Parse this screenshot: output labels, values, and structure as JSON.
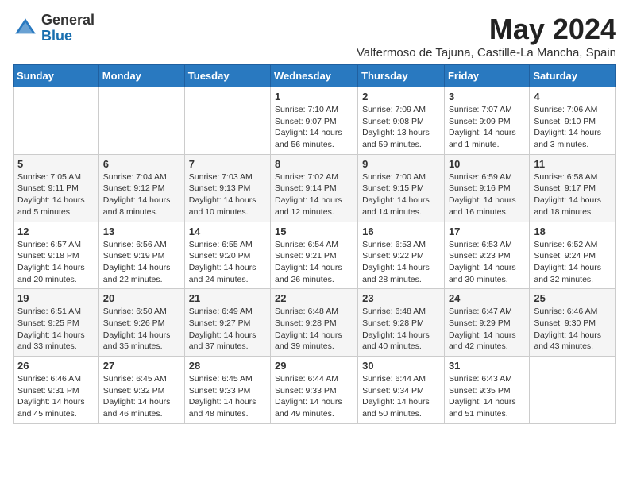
{
  "header": {
    "logo_general": "General",
    "logo_blue": "Blue",
    "month_title": "May 2024",
    "location": "Valfermoso de Tajuna, Castille-La Mancha, Spain"
  },
  "weekdays": [
    "Sunday",
    "Monday",
    "Tuesday",
    "Wednesday",
    "Thursday",
    "Friday",
    "Saturday"
  ],
  "weeks": [
    [
      {
        "day": "",
        "sunrise": "",
        "sunset": "",
        "daylight": ""
      },
      {
        "day": "",
        "sunrise": "",
        "sunset": "",
        "daylight": ""
      },
      {
        "day": "",
        "sunrise": "",
        "sunset": "",
        "daylight": ""
      },
      {
        "day": "1",
        "sunrise": "Sunrise: 7:10 AM",
        "sunset": "Sunset: 9:07 PM",
        "daylight": "Daylight: 14 hours and 56 minutes."
      },
      {
        "day": "2",
        "sunrise": "Sunrise: 7:09 AM",
        "sunset": "Sunset: 9:08 PM",
        "daylight": "Daylight: 13 hours and 59 minutes."
      },
      {
        "day": "3",
        "sunrise": "Sunrise: 7:07 AM",
        "sunset": "Sunset: 9:09 PM",
        "daylight": "Daylight: 14 hours and 1 minute."
      },
      {
        "day": "4",
        "sunrise": "Sunrise: 7:06 AM",
        "sunset": "Sunset: 9:10 PM",
        "daylight": "Daylight: 14 hours and 3 minutes."
      }
    ],
    [
      {
        "day": "5",
        "sunrise": "Sunrise: 7:05 AM",
        "sunset": "Sunset: 9:11 PM",
        "daylight": "Daylight: 14 hours and 5 minutes."
      },
      {
        "day": "6",
        "sunrise": "Sunrise: 7:04 AM",
        "sunset": "Sunset: 9:12 PM",
        "daylight": "Daylight: 14 hours and 8 minutes."
      },
      {
        "day": "7",
        "sunrise": "Sunrise: 7:03 AM",
        "sunset": "Sunset: 9:13 PM",
        "daylight": "Daylight: 14 hours and 10 minutes."
      },
      {
        "day": "8",
        "sunrise": "Sunrise: 7:02 AM",
        "sunset": "Sunset: 9:14 PM",
        "daylight": "Daylight: 14 hours and 12 minutes."
      },
      {
        "day": "9",
        "sunrise": "Sunrise: 7:00 AM",
        "sunset": "Sunset: 9:15 PM",
        "daylight": "Daylight: 14 hours and 14 minutes."
      },
      {
        "day": "10",
        "sunrise": "Sunrise: 6:59 AM",
        "sunset": "Sunset: 9:16 PM",
        "daylight": "Daylight: 14 hours and 16 minutes."
      },
      {
        "day": "11",
        "sunrise": "Sunrise: 6:58 AM",
        "sunset": "Sunset: 9:17 PM",
        "daylight": "Daylight: 14 hours and 18 minutes."
      }
    ],
    [
      {
        "day": "12",
        "sunrise": "Sunrise: 6:57 AM",
        "sunset": "Sunset: 9:18 PM",
        "daylight": "Daylight: 14 hours and 20 minutes."
      },
      {
        "day": "13",
        "sunrise": "Sunrise: 6:56 AM",
        "sunset": "Sunset: 9:19 PM",
        "daylight": "Daylight: 14 hours and 22 minutes."
      },
      {
        "day": "14",
        "sunrise": "Sunrise: 6:55 AM",
        "sunset": "Sunset: 9:20 PM",
        "daylight": "Daylight: 14 hours and 24 minutes."
      },
      {
        "day": "15",
        "sunrise": "Sunrise: 6:54 AM",
        "sunset": "Sunset: 9:21 PM",
        "daylight": "Daylight: 14 hours and 26 minutes."
      },
      {
        "day": "16",
        "sunrise": "Sunrise: 6:53 AM",
        "sunset": "Sunset: 9:22 PM",
        "daylight": "Daylight: 14 hours and 28 minutes."
      },
      {
        "day": "17",
        "sunrise": "Sunrise: 6:53 AM",
        "sunset": "Sunset: 9:23 PM",
        "daylight": "Daylight: 14 hours and 30 minutes."
      },
      {
        "day": "18",
        "sunrise": "Sunrise: 6:52 AM",
        "sunset": "Sunset: 9:24 PM",
        "daylight": "Daylight: 14 hours and 32 minutes."
      }
    ],
    [
      {
        "day": "19",
        "sunrise": "Sunrise: 6:51 AM",
        "sunset": "Sunset: 9:25 PM",
        "daylight": "Daylight: 14 hours and 33 minutes."
      },
      {
        "day": "20",
        "sunrise": "Sunrise: 6:50 AM",
        "sunset": "Sunset: 9:26 PM",
        "daylight": "Daylight: 14 hours and 35 minutes."
      },
      {
        "day": "21",
        "sunrise": "Sunrise: 6:49 AM",
        "sunset": "Sunset: 9:27 PM",
        "daylight": "Daylight: 14 hours and 37 minutes."
      },
      {
        "day": "22",
        "sunrise": "Sunrise: 6:48 AM",
        "sunset": "Sunset: 9:28 PM",
        "daylight": "Daylight: 14 hours and 39 minutes."
      },
      {
        "day": "23",
        "sunrise": "Sunrise: 6:48 AM",
        "sunset": "Sunset: 9:28 PM",
        "daylight": "Daylight: 14 hours and 40 minutes."
      },
      {
        "day": "24",
        "sunrise": "Sunrise: 6:47 AM",
        "sunset": "Sunset: 9:29 PM",
        "daylight": "Daylight: 14 hours and 42 minutes."
      },
      {
        "day": "25",
        "sunrise": "Sunrise: 6:46 AM",
        "sunset": "Sunset: 9:30 PM",
        "daylight": "Daylight: 14 hours and 43 minutes."
      }
    ],
    [
      {
        "day": "26",
        "sunrise": "Sunrise: 6:46 AM",
        "sunset": "Sunset: 9:31 PM",
        "daylight": "Daylight: 14 hours and 45 minutes."
      },
      {
        "day": "27",
        "sunrise": "Sunrise: 6:45 AM",
        "sunset": "Sunset: 9:32 PM",
        "daylight": "Daylight: 14 hours and 46 minutes."
      },
      {
        "day": "28",
        "sunrise": "Sunrise: 6:45 AM",
        "sunset": "Sunset: 9:33 PM",
        "daylight": "Daylight: 14 hours and 48 minutes."
      },
      {
        "day": "29",
        "sunrise": "Sunrise: 6:44 AM",
        "sunset": "Sunset: 9:33 PM",
        "daylight": "Daylight: 14 hours and 49 minutes."
      },
      {
        "day": "30",
        "sunrise": "Sunrise: 6:44 AM",
        "sunset": "Sunset: 9:34 PM",
        "daylight": "Daylight: 14 hours and 50 minutes."
      },
      {
        "day": "31",
        "sunrise": "Sunrise: 6:43 AM",
        "sunset": "Sunset: 9:35 PM",
        "daylight": "Daylight: 14 hours and 51 minutes."
      },
      {
        "day": "",
        "sunrise": "",
        "sunset": "",
        "daylight": ""
      }
    ]
  ]
}
